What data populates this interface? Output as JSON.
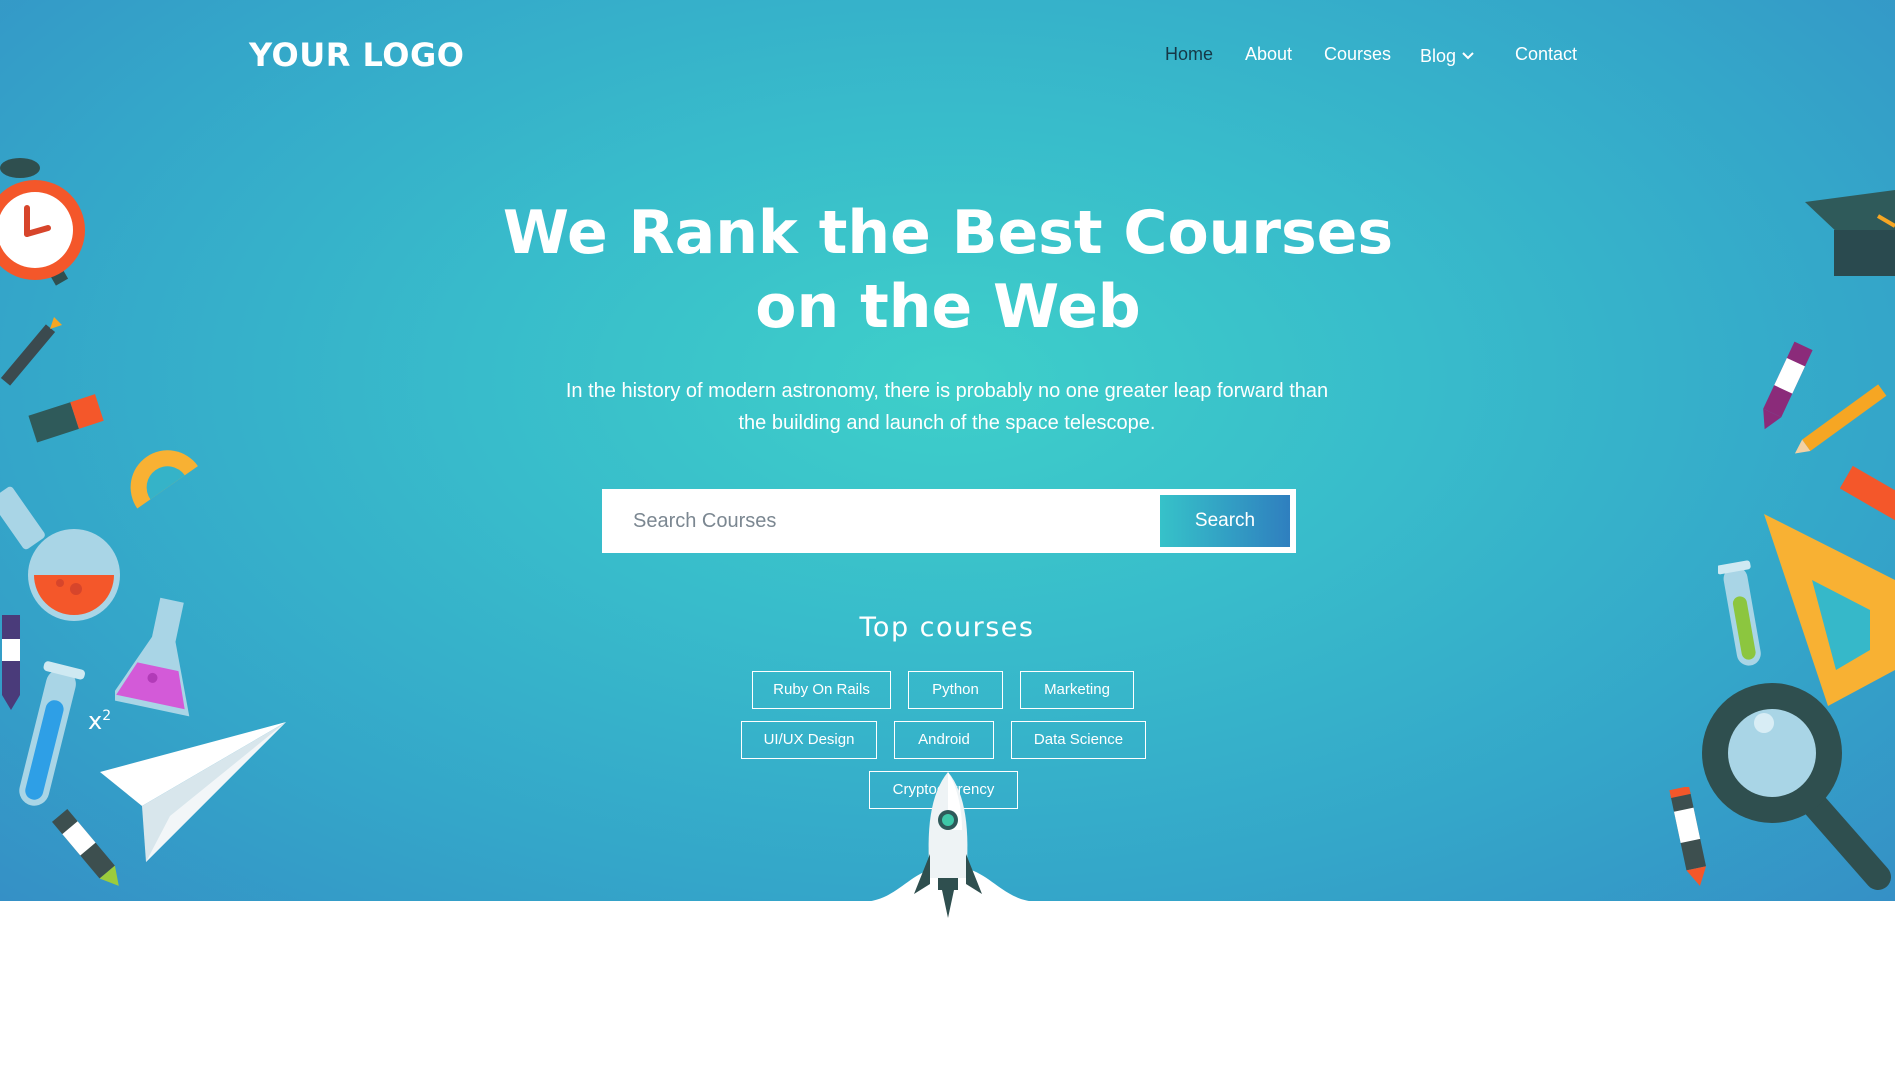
{
  "brand": {
    "logo_text": "YOUR LOGO"
  },
  "nav": {
    "items": [
      {
        "label": "Home"
      },
      {
        "label": "About"
      },
      {
        "label": "Courses"
      },
      {
        "label": "Blog"
      },
      {
        "label": "Contact"
      }
    ],
    "active": "Home"
  },
  "hero": {
    "title_line1": "We Rank the Best Courses",
    "title_line2": "on the Web",
    "subtitle_line1": "In the history of modern astronomy, there is probably no one greater leap forward than",
    "subtitle_line2": "the building and launch of the space telescope."
  },
  "search": {
    "placeholder": "Search Courses",
    "button_label": "Search"
  },
  "top_courses": {
    "heading": "Top courses",
    "tags": [
      "Ruby On Rails",
      "Python",
      "Marketing",
      "UI/UX Design",
      "Android",
      "Data Science",
      "Cryptocurrency"
    ]
  },
  "colors": {
    "hero_center": "#3ecfc9",
    "hero_edge": "#3590c6",
    "nav_active": "#163847",
    "button_start": "#36c2c9",
    "button_end": "#2f7fbf"
  },
  "icons": [
    "alarm-clock-icon",
    "graduation-cap-icon",
    "paper-plane-icon",
    "rocket-icon",
    "magnifier-icon",
    "flask-icon",
    "test-tube-icon",
    "crayon-icon",
    "pencil-icon",
    "protractor-icon",
    "triangle-ruler-icon",
    "eraser-icon"
  ]
}
